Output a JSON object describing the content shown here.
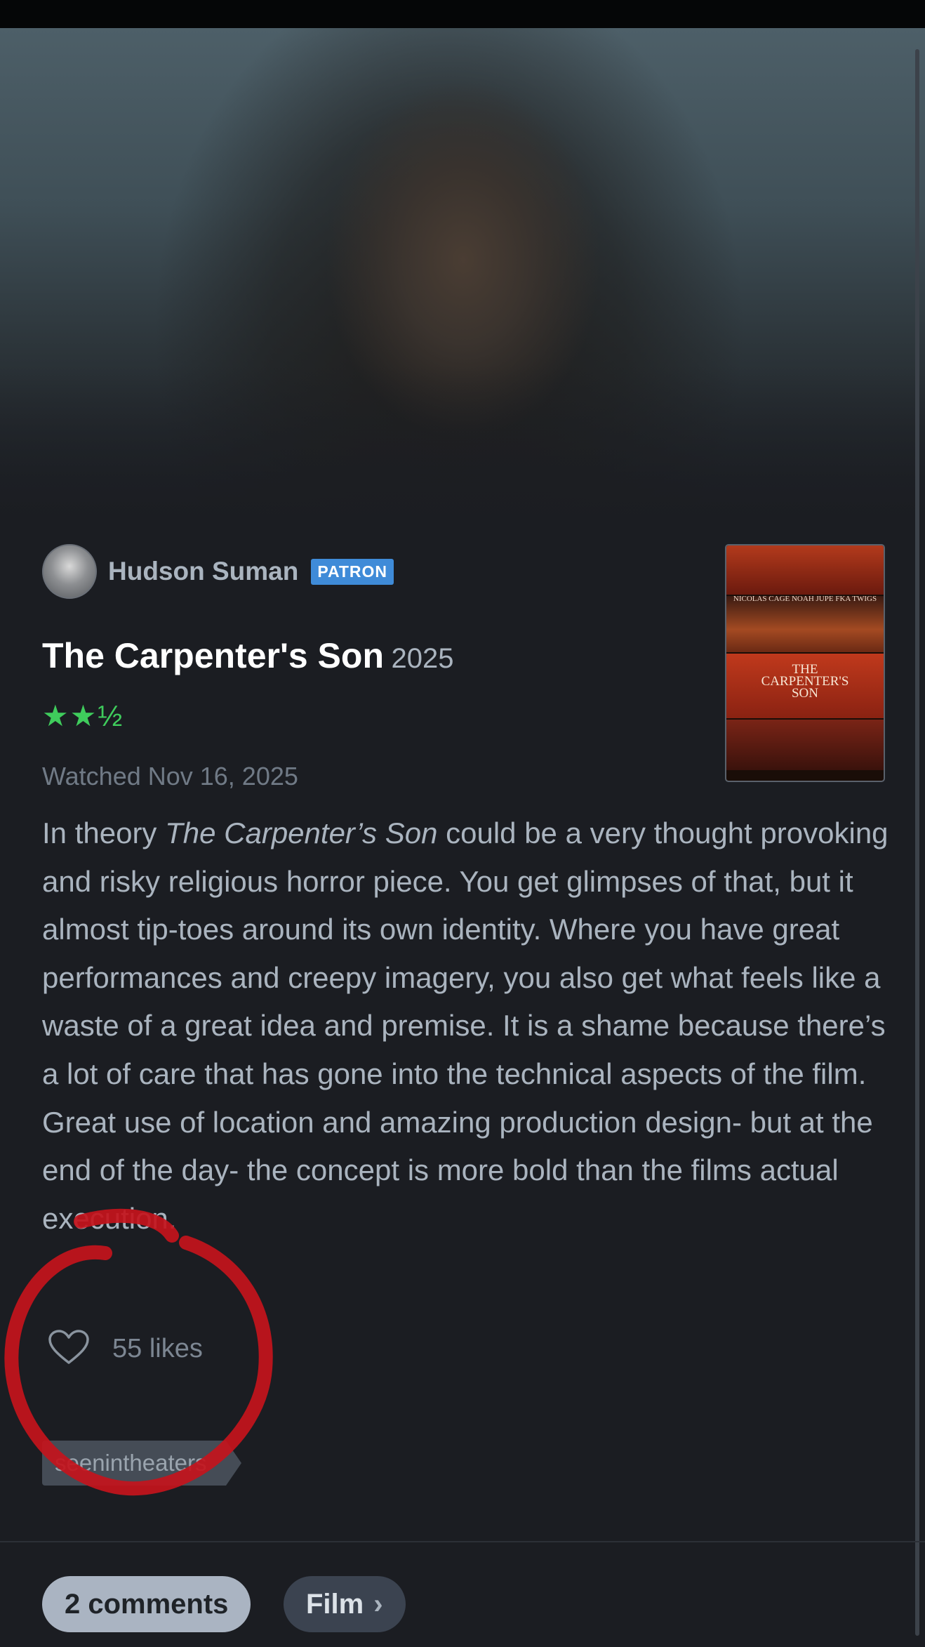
{
  "review": {
    "author": {
      "name": "Hudson Suman",
      "badge": "PATRON"
    },
    "film": {
      "title": "The Carpenter's Son",
      "year": "2025"
    },
    "rating": {
      "stars": 2.5,
      "display": "★★½",
      "color": "#3fcc5c"
    },
    "watched": "Watched Nov 16, 2025",
    "body_segments": [
      "In theory ",
      "The Carpenter’s Son",
      " could be a very thought provoking and risky religious horror piece. You get glimpses of that, but it almost tip-toes around its own identity. Where you have great performances and creepy imagery, you also get what feels like a waste of a great idea and premise. It is a shame because there’s a lot of care that has gone into the technical aspects of the film. Great use of location and amazing production design- but at the end of the day- the concept is more bold than the films actual execution."
    ],
    "likes": "55 likes",
    "tag": "seenintheaters"
  },
  "poster": {
    "cast_line": "NICOLAS CAGE  NOAH JUPE  FKA TWIGS",
    "title": "THE\nCARPENTER'S\nSON"
  },
  "footer": {
    "comments_label": "2 comments",
    "film_label": "Film"
  },
  "colors": {
    "background": "#1b1d22",
    "accent_badge": "#3f8bd8",
    "annotation": "#c4141c"
  }
}
